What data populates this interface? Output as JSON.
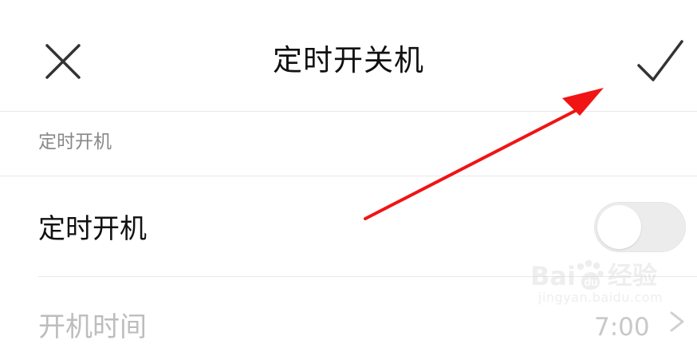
{
  "header": {
    "title": "定时开关机",
    "close_icon": "close-icon",
    "confirm_icon": "check-icon"
  },
  "section": {
    "title": "定时开机"
  },
  "power_on_row": {
    "label": "定时开机",
    "toggle_state": "off",
    "toggle_color": "#ececec"
  },
  "time_row": {
    "label": "开机时间",
    "value": "7:00",
    "chevron_icon": "chevron-right-icon"
  },
  "annotation": {
    "icon": "red-arrow-icon",
    "color": "#f01414"
  },
  "watermark": {
    "left_text": "Bai",
    "middle_text": "du",
    "right_text": "经验",
    "sub_text": "jingyan.baidu.com",
    "icon": "paw-icon"
  }
}
